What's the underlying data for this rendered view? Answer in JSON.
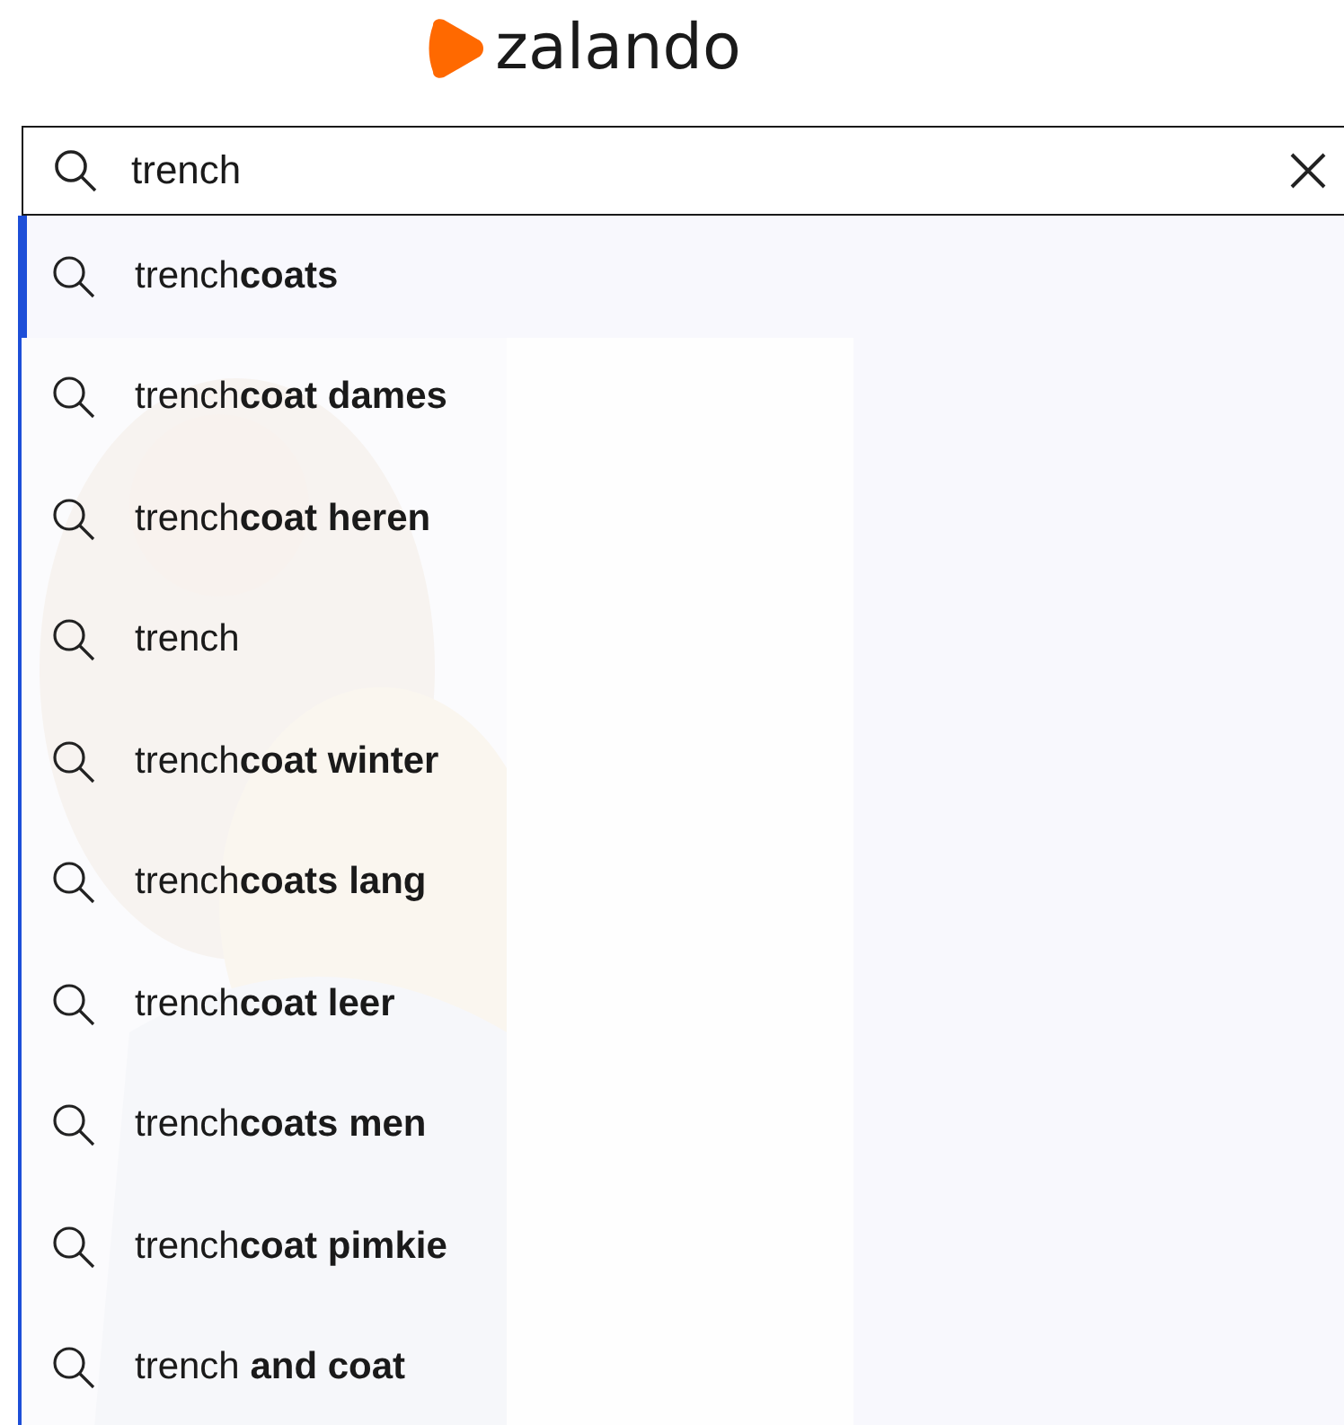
{
  "logo": {
    "text": "zalando"
  },
  "search": {
    "value": "trench"
  },
  "suggestions": [
    {
      "text": "trench**coats**",
      "selected": true
    },
    {
      "text": "trench**coat dames**",
      "selected": false
    },
    {
      "text": "trench**coat heren**",
      "selected": false
    },
    {
      "text": "trench",
      "selected": false
    },
    {
      "text": "trench**coat winter**",
      "selected": false
    },
    {
      "text": "trench**coats lang**",
      "selected": false
    },
    {
      "text": "trench**coat leer**",
      "selected": false
    },
    {
      "text": "trench**coats men**",
      "selected": false
    },
    {
      "text": "trench**coat pimkie**",
      "selected": false
    },
    {
      "text": "trench **and coat**",
      "selected": false
    }
  ]
}
